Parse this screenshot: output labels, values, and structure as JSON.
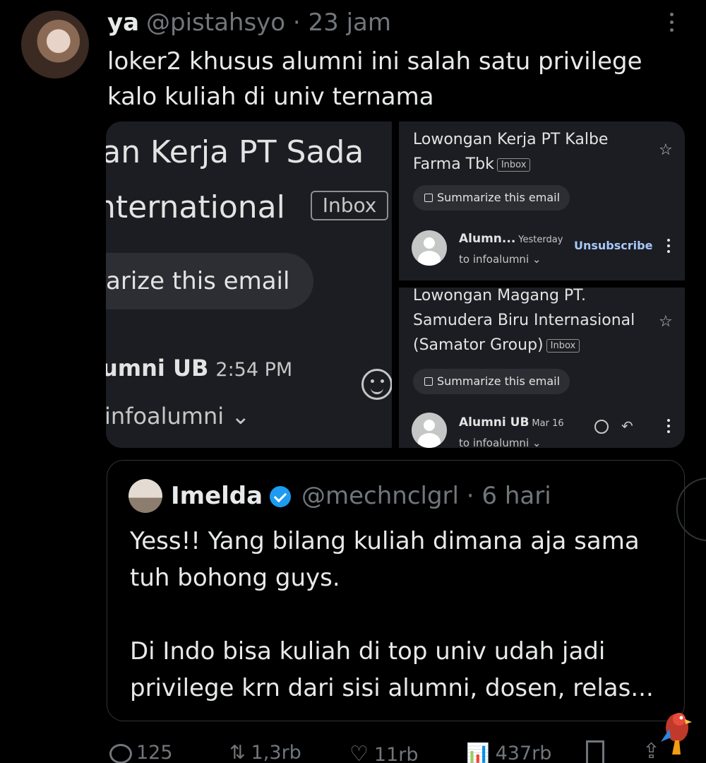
{
  "post": {
    "name": "ya",
    "handle_time": "@pistahsyo · 23 jam",
    "text": "loker2 khusus alumni ini salah satu privilege kalo kuliah di univ ternama"
  },
  "media": {
    "left": {
      "title_line1": "jan Kerja PT Sada",
      "title_line2": "nternational",
      "inbox": "Inbox",
      "summarize": "arize this email",
      "sender": "umni UB",
      "time": "2:54 PM",
      "to": "infoalumni ⌄"
    },
    "right_top": {
      "title_line1": "Lowongan Kerja PT Kalbe",
      "title_line2": "Farma Tbk",
      "inbox": "Inbox",
      "summarize": "Summarize this email",
      "sender": "Alumn...",
      "time": "Yesterday",
      "to": "to infoalumni ⌄",
      "unsubscribe": "Unsubscribe"
    },
    "right_bottom": {
      "title_line1": "Lowongan Magang PT.",
      "title_line2": "Samudera Biru Internasional",
      "title_line3": "(Samator Group)",
      "inbox": "Inbox",
      "summarize": "Summarize this email",
      "sender": "Alumni UB",
      "time": "Mar 16",
      "to": "to infoalumni ⌄"
    }
  },
  "quote": {
    "name": "Imelda",
    "handle_time": "@mechnclgrl · 6 hari",
    "text": "Yess!! Yang bilang kuliah dimana aja sama tuh bohong guys.\n\nDi Indo bisa kuliah di top univ udah jadi privilege krn dari sisi alumni, dosen, relas..."
  },
  "actions": {
    "replies": "125",
    "reposts": "1,3rb",
    "likes": "11rb",
    "views": "437rb"
  },
  "icons": {
    "star": "☆",
    "repost": "⇅",
    "heart": "♡",
    "views": "📊",
    "share": "⇪",
    "reply": "↶"
  }
}
